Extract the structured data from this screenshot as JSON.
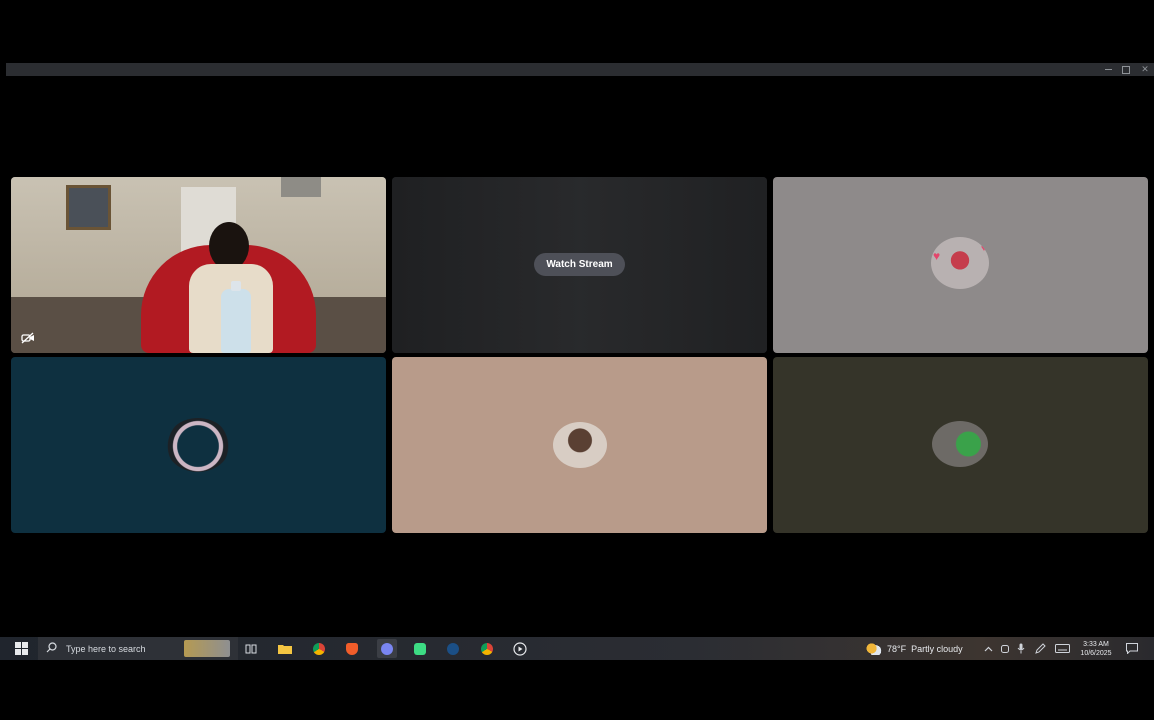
{
  "window": {
    "controls": {
      "minimize": "–",
      "maximize": "□",
      "close": "✕"
    }
  },
  "stream_tile": {
    "button_label": "Watch Stream"
  },
  "tiles": [
    {
      "type": "camera",
      "camera_icon": "camera-off-icon"
    },
    {
      "type": "stream"
    },
    {
      "type": "avatar",
      "bg": "#8e8a8a"
    },
    {
      "type": "avatar",
      "bg": "#0e3040"
    },
    {
      "type": "avatar",
      "bg": "#b89b8a"
    },
    {
      "type": "avatar",
      "bg": "#353429"
    }
  ],
  "taskbar": {
    "search_placeholder": "Type here to search",
    "apps": [
      "task-view-icon",
      "file-explorer-icon",
      "chrome-icon",
      "brave-icon",
      "discord-icon",
      "android-icon",
      "steam-icon",
      "chrome-profile-icon",
      "media-player-icon"
    ],
    "weather": {
      "temp": "78°F",
      "condition": "Partly cloudy"
    },
    "clock": {
      "time": "3:33 AM",
      "date": "10/6/2025"
    }
  }
}
